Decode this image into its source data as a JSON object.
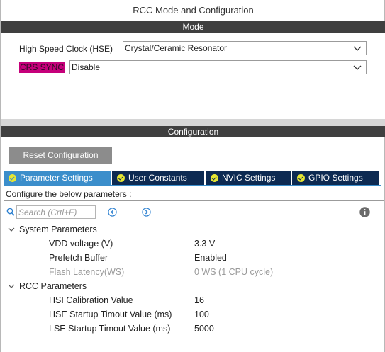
{
  "window": {
    "title": "RCC Mode and Configuration"
  },
  "mode": {
    "header": "Mode",
    "hse": {
      "label": "High Speed Clock (HSE)",
      "value": "Crystal/Ceramic Resonator"
    },
    "crs": {
      "label": "CRS SYNC",
      "value": "Disable"
    }
  },
  "configuration": {
    "header": "Configuration",
    "reset_label": "Reset Configuration",
    "tabs": [
      {
        "label": "Parameter Settings",
        "active": true
      },
      {
        "label": "User Constants",
        "active": false
      },
      {
        "label": "NVIC Settings",
        "active": false
      },
      {
        "label": "GPIO Settings",
        "active": false
      }
    ],
    "hint": "Configure the below parameters :",
    "search": {
      "placeholder": "Search (Crtl+F)"
    },
    "groups": [
      {
        "name": "System Parameters",
        "params": [
          {
            "name": "VDD voltage (V)",
            "value": "3.3 V",
            "disabled": false
          },
          {
            "name": "Prefetch Buffer",
            "value": "Enabled",
            "disabled": false
          },
          {
            "name": "Flash Latency(WS)",
            "value": "0 WS (1 CPU cycle)",
            "disabled": true
          }
        ]
      },
      {
        "name": "RCC Parameters",
        "params": [
          {
            "name": "HSI Calibration Value",
            "value": "16",
            "disabled": false
          },
          {
            "name": "HSE Startup Timout Value (ms)",
            "value": "100",
            "disabled": false
          },
          {
            "name": "LSE Startup Timout Value (ms)",
            "value": "5000",
            "disabled": false
          }
        ]
      }
    ]
  },
  "colors": {
    "header_bg": "#3f3f3f",
    "tab_active": "#3b8ecb",
    "tab_inactive": "#0d2a52",
    "crs_highlight": "#c5007a",
    "reset_button": "#8c8c8c"
  },
  "icons": [
    "chevron-down-icon",
    "check-circle-icon",
    "search-icon",
    "chevron-left-circle-icon",
    "chevron-right-circle-icon",
    "info-icon"
  ]
}
